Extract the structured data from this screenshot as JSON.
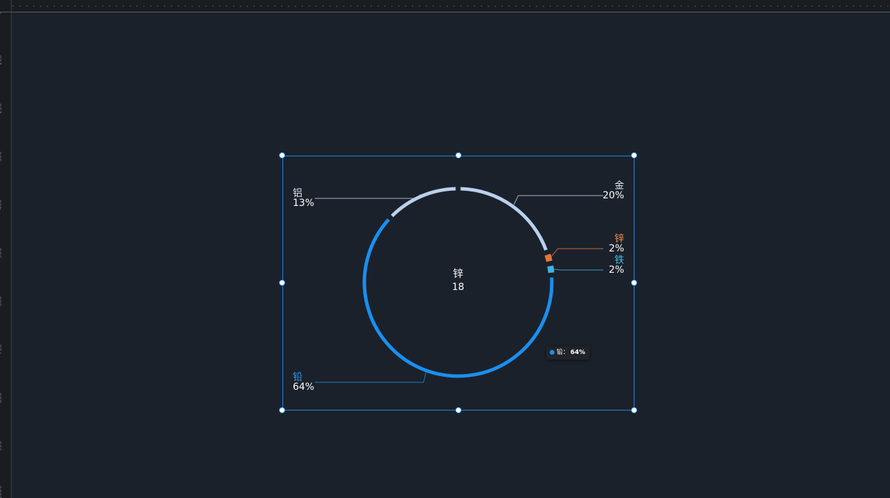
{
  "ruler": {
    "ticks": [
      "0",
      "100",
      "200",
      "300",
      "400",
      "500",
      "600",
      "700",
      "800",
      "900",
      "1000"
    ]
  },
  "colors": {
    "background": "#1b212a",
    "selection": "#1f86e6",
    "label_text": "#ffffff"
  },
  "chart_data": {
    "type": "pie",
    "variant": "ring",
    "center": {
      "name": "锌",
      "value": "18"
    },
    "slices": [
      {
        "name": "金",
        "percent": 20,
        "label": "20%",
        "color": "#b9d0ee",
        "label_color": "#d9e6f7",
        "side": "right"
      },
      {
        "name": "锌",
        "percent": 2,
        "label": "2%",
        "color": "#e5773c",
        "label_color": "#ef8a4c",
        "side": "right"
      },
      {
        "name": "铁",
        "percent": 2,
        "label": "2%",
        "color": "#3fb1e3",
        "label_color": "#46b8ea",
        "side": "right"
      },
      {
        "name": "铅",
        "percent": 64,
        "label": "64%",
        "color": "#1a8ff0",
        "label_color": "#2a98f2",
        "side": "left"
      },
      {
        "name": "铝",
        "percent": 13,
        "label": "13%",
        "color": "#b9d0ee",
        "label_color": "#d9e6f7",
        "side": "left"
      }
    ]
  },
  "tooltip": {
    "name": "铅",
    "separator": "：",
    "value": "64%",
    "color": "#1a8ff0"
  }
}
